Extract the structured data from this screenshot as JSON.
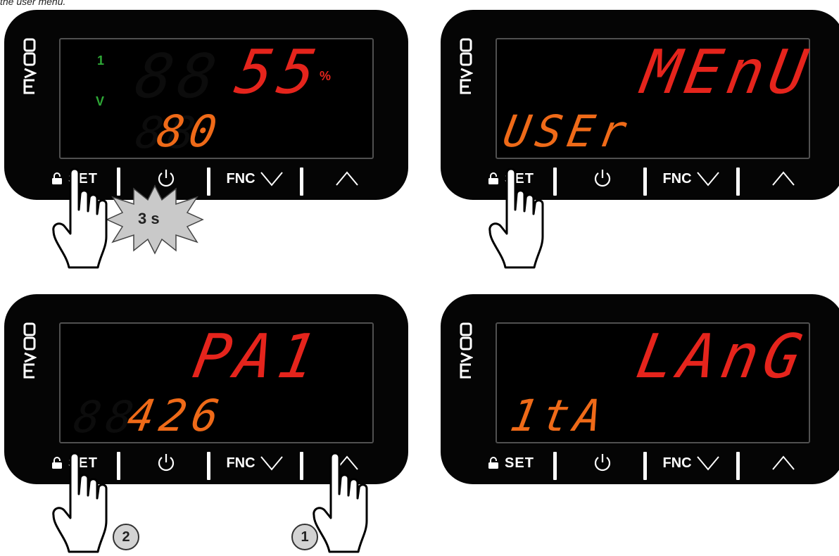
{
  "caption": "the user menu.",
  "brand_logo": "EVCO",
  "buttons": {
    "set_label": "SET",
    "fnc_label": "FNC"
  },
  "icons": {
    "lock": "lock-icon",
    "power": "power-icon",
    "down": "chevron-down-icon",
    "up": "chevron-up-icon",
    "hand": "pointing-hand-icon"
  },
  "panels": [
    {
      "top_display": "55",
      "top_unit": "%",
      "bottom_display": "80",
      "indicator_1": "1",
      "indicator_2": "V",
      "hold_label": "3 s"
    },
    {
      "top_display": "MEnU",
      "bottom_display": "USEr"
    },
    {
      "top_display": "PA1",
      "bottom_display": "426",
      "step_badges": [
        "2",
        "1"
      ]
    },
    {
      "top_display": "LAnG",
      "bottom_display": "1tA"
    }
  ],
  "colors": {
    "display_top": "#e5241c",
    "display_bottom": "#ef6a18",
    "indicator": "#2ea836",
    "device_body": "#050505"
  }
}
